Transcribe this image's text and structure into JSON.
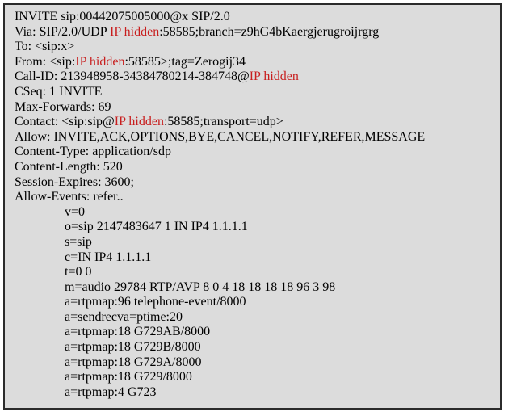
{
  "colors": {
    "panel_bg": "#dcdcdc",
    "border": "#2b2b2b",
    "text": "#000000",
    "highlight": "#c81e1e"
  },
  "headers": [
    [
      {
        "t": "INVITE sip:00442075005000@x SIP/2.0"
      }
    ],
    [
      {
        "t": "Via: SIP/2.0/UDP "
      },
      {
        "t": "IP hidden",
        "red": true
      },
      {
        "t": ":58585;branch=z9hG4bKaergjerugroijrgrg"
      }
    ],
    [
      {
        "t": "To: <sip:x>"
      }
    ],
    [
      {
        "t": "From: <sip:"
      },
      {
        "t": "IP hidden",
        "red": true
      },
      {
        "t": ":58585>;tag=Zerogij34"
      }
    ],
    [
      {
        "t": "Call-ID: 213948958-34384780214-384748@"
      },
      {
        "t": "IP hidden",
        "red": true
      }
    ],
    [
      {
        "t": "CSeq: 1 INVITE"
      }
    ],
    [
      {
        "t": "Max-Forwards: 69"
      }
    ],
    [
      {
        "t": "Contact: <sip:sip@"
      },
      {
        "t": "IP hidden",
        "red": true
      },
      {
        "t": ":58585;transport=udp>"
      }
    ],
    [
      {
        "t": "Allow: INVITE,ACK,OPTIONS,BYE,CANCEL,NOTIFY,REFER,MESSAGE"
      }
    ],
    [
      {
        "t": "Content-Type: application/sdp"
      }
    ],
    [
      {
        "t": "Content-Length: 520"
      }
    ],
    [
      {
        "t": "Session-Expires: 3600;"
      }
    ],
    [
      {
        "t": "Allow-Events: refer.."
      }
    ]
  ],
  "sdp": [
    "v=0",
    "o=sip 2147483647 1 IN IP4 1.1.1.1",
    "s=sip",
    "c=IN IP4 1.1.1.1",
    "t=0 0",
    "m=audio 29784 RTP/AVP 8 0 4 18 18 18 18 96 3 98",
    "a=rtpmap:96 telephone-event/8000",
    "a=sendrecva=ptime:20",
    "a=rtpmap:18 G729AB/8000",
    "a=rtpmap:18 G729B/8000",
    "a=rtpmap:18 G729A/8000",
    "a=rtpmap:18 G729/8000",
    "a=rtpmap:4 G723"
  ]
}
